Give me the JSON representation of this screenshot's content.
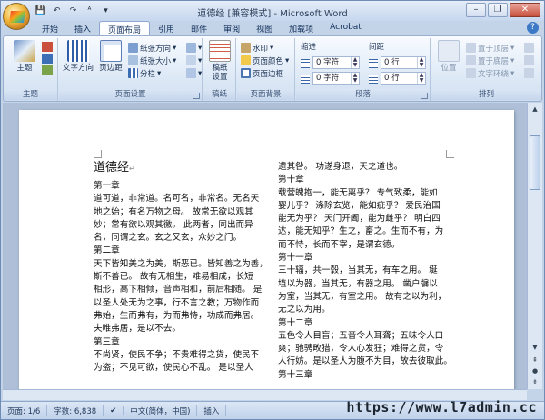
{
  "window": {
    "title": "道德经 [兼容模式] - Microsoft Word"
  },
  "qat": {
    "save": "💾",
    "undo": "↶",
    "redo": "↷",
    "format": "ᴬ",
    "dd": "▾"
  },
  "tabs": [
    "开始",
    "插入",
    "页面布局",
    "引用",
    "邮件",
    "审阅",
    "视图",
    "加载项",
    "Acrobat"
  ],
  "ribbon": {
    "theme": {
      "label": "主题",
      "group": "主题"
    },
    "page_setup": {
      "text_dir": "文字方向",
      "margins": "页边距",
      "orientation": "纸张方向",
      "size": "纸张大小",
      "columns": "分栏",
      "breaks": "",
      "line_num": "",
      "hyphen": "",
      "group": "页面设置"
    },
    "draft": {
      "label": "稿纸\n设置",
      "group": "稿纸"
    },
    "background": {
      "watermark": "水印",
      "color": "页面颜色",
      "border": "页面边框",
      "group": "页面背景"
    },
    "paragraph": {
      "indent": "缩进",
      "spacing": "间距",
      "left": "0 字符",
      "right": "0 字符",
      "before": "0 行",
      "after": "0 行",
      "group": "段落"
    },
    "arrange": {
      "position": "位置",
      "front": "置于顶层",
      "back": "置于底层",
      "wrap": "文字环绕",
      "group": "排列"
    }
  },
  "document": {
    "title": "道德经",
    "left": [
      "第一章",
      "道可道，非常道。名可名，非常名。无名天",
      "地之始；有名万物之母。 故常无欲以观其",
      "妙；常有欲以观其徼。 此两者，同出而异",
      "名，同谓之玄。玄之又玄，众妙之门。",
      "第二章",
      "天下皆知美之为美，斯恶已。皆知善之为善，",
      "斯不善已。 故有无相生，难易相成，长短",
      "相形，高下相倾，音声相和，前后相随。 是",
      "以圣人处无为之事，行不言之教；万物作而",
      "弗始，生而弗有，为而弗恃，功成而弗居。",
      "夫唯弗居，是以不去。",
      "第三章",
      "不尚贤，使民不争；不贵难得之货，使民不",
      "为盗；不见可欲，使民心不乱。 是以圣人"
    ],
    "right": [
      "遗其咎。 功遂身退，天之道也。",
      "第十章",
      "载营魄抱一，能无离乎？ 专气致柔，能如",
      "婴儿乎？ 涤除玄览，能如疵乎？ 爱民治国",
      "能无为乎？ 天门开阖，能为雌乎？ 明白四",
      "达，能无知乎？生之，畜之。生而不有，为",
      "而不恃，长而不宰，是谓玄德。",
      "第十一章",
      "三十辐，共一毂，当其无，有车之用。 埏",
      "埴以为器，当其无，有器之用。 凿户牖以",
      "为室，当其无，有室之用。 故有之以为利，",
      "无之以为用。",
      "第十二章",
      "五色令人目盲；五音令人耳聋；五味令人口",
      "爽；驰骋畋猎，令人心发狂；难得之货，令",
      "人行妨。是以圣人为腹不为目，故去彼取此。",
      "第十三章"
    ]
  },
  "status": {
    "page": "页面: 1/6",
    "words": "字数: 6,838",
    "lang": "中文(简体，中国)",
    "mode": "插入"
  },
  "watermark": "https://www.l7admin.cc"
}
